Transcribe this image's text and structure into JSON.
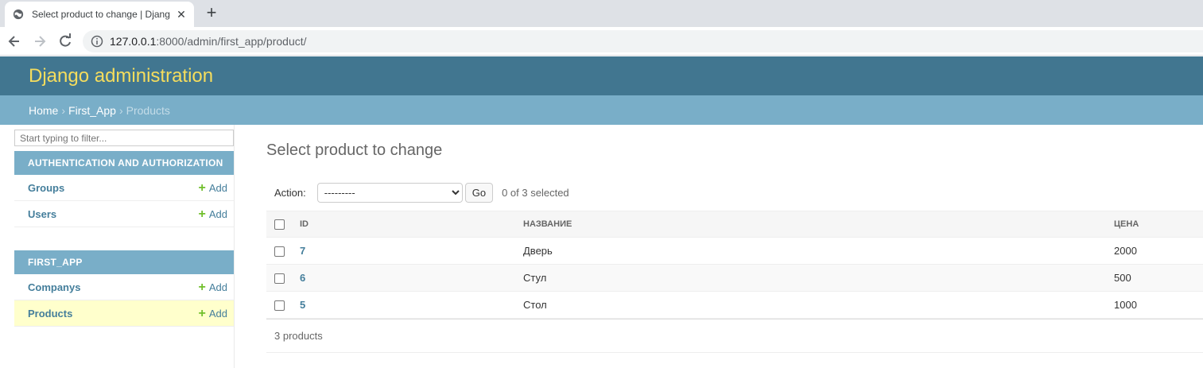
{
  "browser": {
    "tab_title": "Select product to change | Django site admin",
    "url_host": "127.0.0.1",
    "url_path": ":8000/admin/first_app/product/"
  },
  "header": {
    "brand": "Django administration"
  },
  "breadcrumbs": {
    "home": "Home",
    "app": "First_App",
    "current": "Products",
    "separator": "›"
  },
  "sidebar": {
    "filter_placeholder": "Start typing to filter...",
    "modules": [
      {
        "caption": "AUTHENTICATION AND AUTHORIZATION",
        "models": [
          {
            "name": "Groups",
            "add": "Add"
          },
          {
            "name": "Users",
            "add": "Add"
          }
        ]
      },
      {
        "caption": "FIRST_APP",
        "models": [
          {
            "name": "Companys",
            "add": "Add"
          },
          {
            "name": "Products",
            "add": "Add"
          }
        ]
      }
    ]
  },
  "content": {
    "title": "Select product to change",
    "action_label": "Action:",
    "action_selected": "---------",
    "go_label": "Go",
    "selected_count": "0 of 3 selected",
    "columns": [
      "ID",
      "НАЗВАНИЕ",
      "ЦЕНА"
    ],
    "rows": [
      {
        "id": "7",
        "name": "Дверь",
        "price": "2000"
      },
      {
        "id": "6",
        "name": "Стул",
        "price": "500"
      },
      {
        "id": "5",
        "name": "Стол",
        "price": "1000"
      }
    ],
    "paginator": "3 products"
  },
  "colors": {
    "header_bg": "#417690",
    "brand_color": "#f5dd5d",
    "breadcrumbs_bg": "#79aec8",
    "link_color": "#447e9b",
    "add_icon_color": "#70bf2b",
    "current_row_bg": "#ffffcc"
  }
}
